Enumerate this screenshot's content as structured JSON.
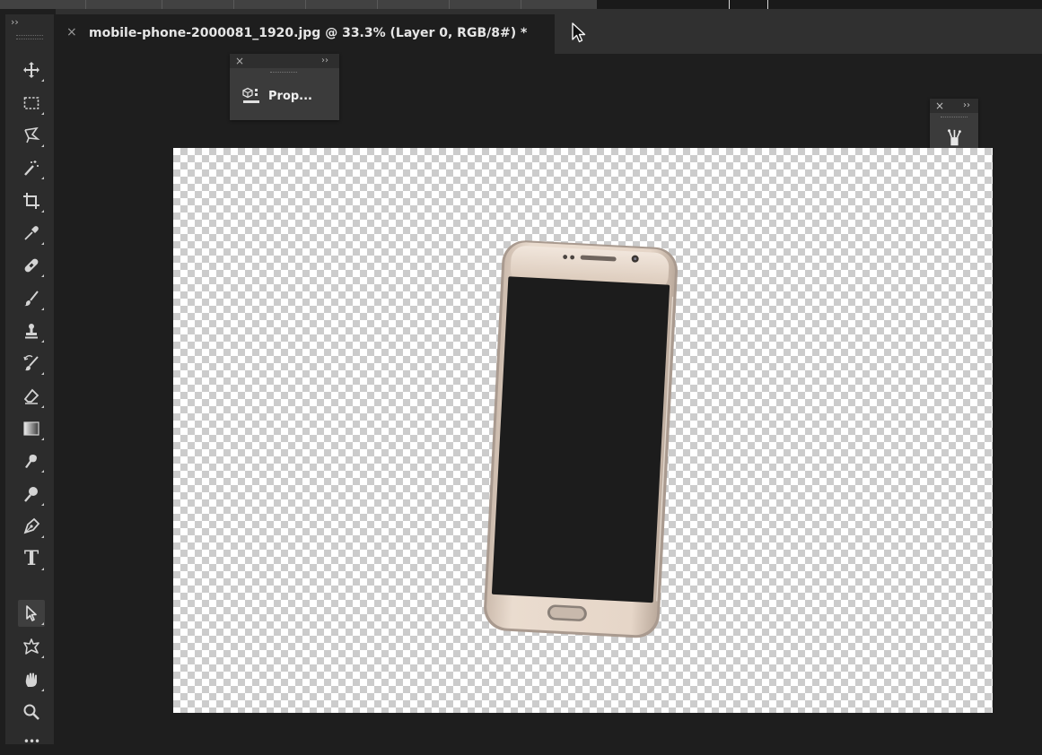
{
  "document": {
    "tab_title": "mobile-phone-2000081_1920.jpg @ 33.3% (Layer 0, RGB/8#) *",
    "close_glyph": "×"
  },
  "toolbar": {
    "collapse_glyph": "››",
    "tools": [
      {
        "name": "move-tool",
        "icon": "move-icon"
      },
      {
        "name": "rectangular-marquee-tool",
        "icon": "marquee-icon"
      },
      {
        "name": "lasso-tool",
        "icon": "lasso-icon"
      },
      {
        "name": "magic-wand-tool",
        "icon": "magic-wand-icon"
      },
      {
        "name": "crop-tool",
        "icon": "crop-icon"
      },
      {
        "name": "eyedropper-tool",
        "icon": "eyedropper-icon"
      },
      {
        "name": "healing-brush-tool",
        "icon": "bandage-icon"
      },
      {
        "name": "brush-tool",
        "icon": "brush-icon"
      },
      {
        "name": "clone-stamp-tool",
        "icon": "stamp-icon"
      },
      {
        "name": "history-brush-tool",
        "icon": "history-brush-icon"
      },
      {
        "name": "eraser-tool",
        "icon": "eraser-icon"
      },
      {
        "name": "gradient-tool",
        "icon": "gradient-icon"
      },
      {
        "name": "smudge-tool",
        "icon": "smudge-icon"
      },
      {
        "name": "dodge-tool",
        "icon": "dodge-icon"
      },
      {
        "name": "pen-tool",
        "icon": "pen-icon"
      },
      {
        "name": "type-tool",
        "icon": "type-icon",
        "glyph": "T"
      },
      {
        "name": "path-selection-tool",
        "icon": "arrow-icon",
        "active": true
      },
      {
        "name": "custom-shape-tool",
        "icon": "shape-icon"
      },
      {
        "name": "hand-tool",
        "icon": "hand-icon"
      },
      {
        "name": "zoom-tool",
        "icon": "zoom-icon"
      },
      {
        "name": "more-tools",
        "icon": "more-icon",
        "glyph": "•••"
      }
    ]
  },
  "properties_panel": {
    "close_glyph": "×",
    "collapse_glyph": "››",
    "label": "Prop..."
  },
  "mini_panel": {
    "close_glyph": "×",
    "collapse_glyph": "››",
    "items": [
      {
        "name": "brushes-panel-button",
        "icon": "brushes-icon"
      },
      {
        "name": "adjustments-panel-button",
        "icon": "sliders-icon"
      }
    ]
  },
  "colors": {
    "app_background": "#1e1e1e",
    "panel": "#3b3b3b",
    "toolbar": "#2c2c2c",
    "phone_body": "#e4d3c3",
    "phone_screen": "#1c1c1c"
  }
}
